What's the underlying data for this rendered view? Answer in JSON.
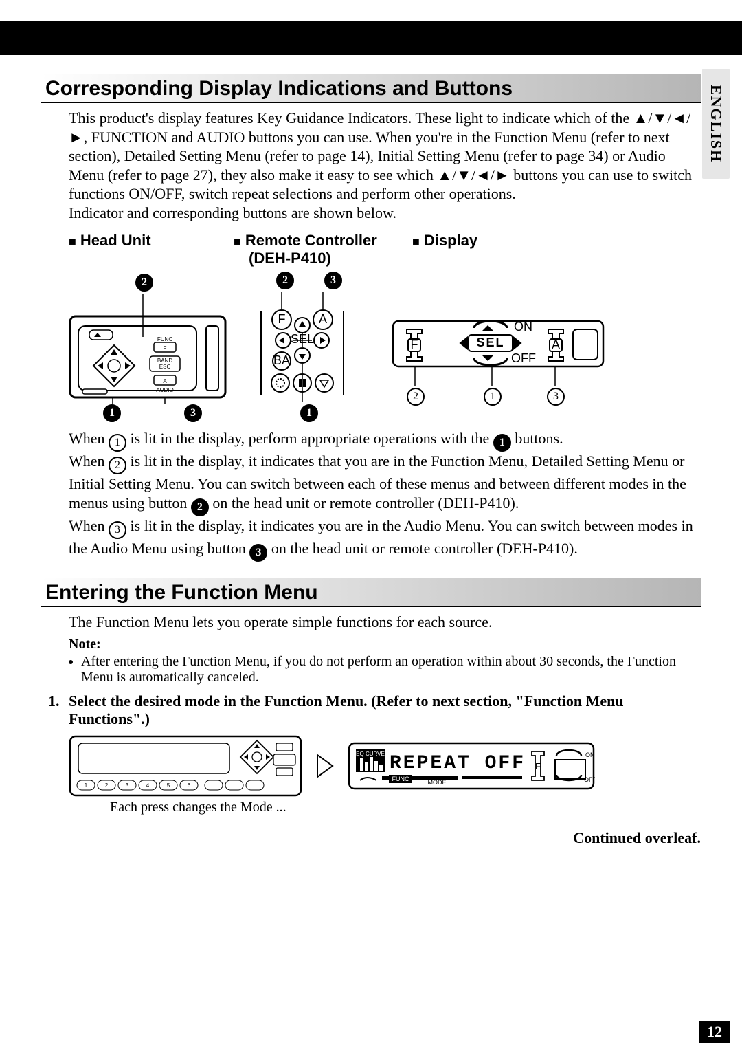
{
  "language_tab": "ENGLISH",
  "page_number": "12",
  "section1": {
    "title": "Corresponding Display Indications and Buttons",
    "para": "This product's display features Key Guidance Indicators. These light to indicate which of the ▲/▼/◄/►, FUNCTION and AUDIO buttons you can use. When you're in the Function Menu (refer to next section), Detailed Setting Menu (refer to page 14), Initial Setting Menu (refer to page 34) or Audio Menu (refer to page 27), they also make it easy to see which ▲/▼/◄/► buttons you can use to switch functions ON/OFF, switch repeat selections and perform other operations.",
    "para_line2": "Indicator and corresponding buttons are shown below.",
    "subheads": {
      "head_unit": "Head Unit",
      "remote": "Remote Controller",
      "remote_model": "(DEH-P410)",
      "display": "Display"
    },
    "diagram": {
      "head_unit_top": [
        "2"
      ],
      "head_unit_bottom": [
        "1",
        "3"
      ],
      "remote_top": [
        "2",
        "3"
      ],
      "remote_bottom": [
        "1"
      ],
      "display_bottom": [
        "2",
        "1",
        "3"
      ],
      "remote_buttons": {
        "F": "F",
        "A": "A",
        "SEL": "SEL",
        "BA": "BA"
      },
      "display_labels": {
        "F": "F",
        "A": "A",
        "SEL": "SEL",
        "ON": "ON",
        "OFF": "OFF"
      },
      "head_unit_labels": {
        "FUNC": "FUNC",
        "F": "F",
        "BAND": "BAND",
        "ESC": "ESC",
        "A": "A",
        "AUDIO": "AUDIO"
      }
    },
    "explain_p1a": "When ",
    "explain_p1b": " is lit in the display, perform appropriate operations with the ",
    "explain_p1c": " buttons.",
    "explain_p2a": "When ",
    "explain_p2b": " is lit in the display, it indicates that you are in the Function Menu, Detailed Setting Menu or Initial Setting Menu. You can switch between each of these menus and between different modes in the menus using button ",
    "explain_p2c": " on the head unit or remote controller (DEH-P410).",
    "explain_p3a": "When ",
    "explain_p3b": " is lit in the display, it indicates you are in the Audio Menu. You can switch between modes in the Audio Menu using button ",
    "explain_p3c": " on the head unit or remote controller (DEH-P410)."
  },
  "section2": {
    "title": "Entering the Function Menu",
    "intro": "The Function Menu lets you operate simple functions for each source.",
    "note_label": "Note:",
    "note_item": "After entering the Function Menu, if you do not perform an operation within about 30 seconds, the Function Menu is automatically canceled.",
    "step_num": "1.",
    "step_text": "Select the desired mode in the Function Menu. (Refer to next section, \"Function Menu Functions\".)",
    "display_example": {
      "eq_curve": "EQ CURVE",
      "main": "REPEAT  OFF",
      "func": "FUNC",
      "mode": "MODE",
      "on": "ON",
      "off": "OFF",
      "F": "F"
    },
    "step_caption": "Each press changes the Mode ...",
    "continued": "Continued overleaf."
  }
}
